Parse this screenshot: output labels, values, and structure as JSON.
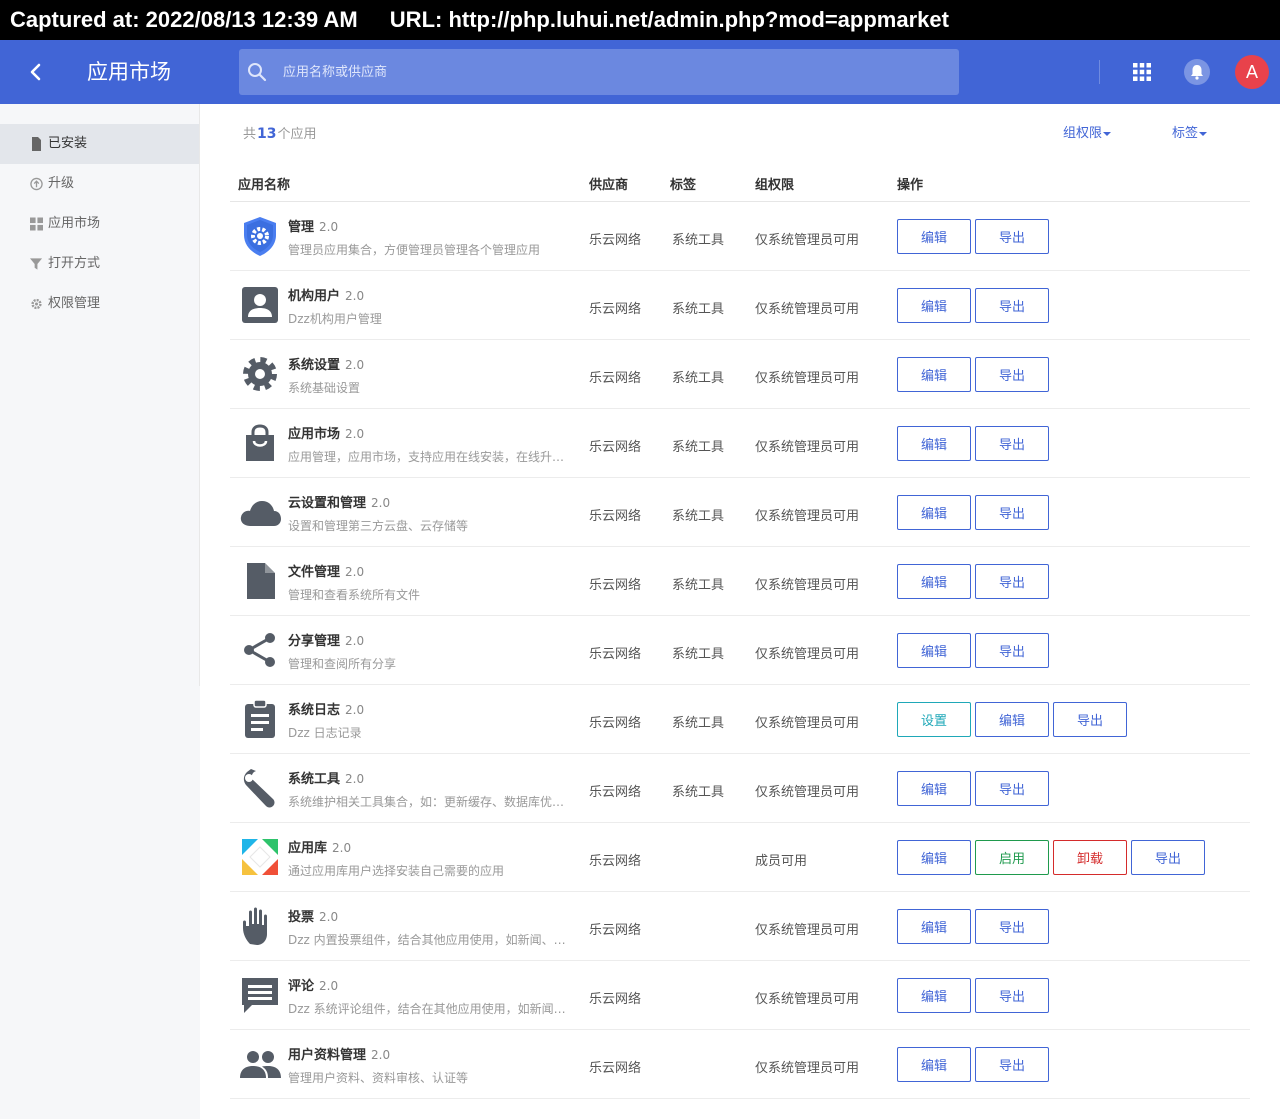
{
  "capture": {
    "time": "Captured at: 2022/08/13 12:39 AM",
    "url": "URL: http://php.luhui.net/admin.php?mod=appmarket"
  },
  "header": {
    "title": "应用市场",
    "search_placeholder": "应用名称或供应商",
    "avatar_letter": "A",
    "icons": [
      "back-icon",
      "search-icon",
      "apps-grid-icon",
      "bell-icon"
    ]
  },
  "colors": {
    "primary": "#4165d6",
    "avatar": "#e8424b",
    "setting": "#1fa8b8",
    "enable": "#1f9a4d",
    "uninstall": "#d42b2b"
  },
  "sidebar": {
    "items": [
      {
        "label": "已安装",
        "icon": "file-icon",
        "active": true
      },
      {
        "label": "升级",
        "icon": "upgrade-icon",
        "active": false
      },
      {
        "label": "应用市场",
        "icon": "grid-icon",
        "active": false
      },
      {
        "label": "打开方式",
        "icon": "filter-icon",
        "active": false
      },
      {
        "label": "权限管理",
        "icon": "gear-icon",
        "active": false
      }
    ]
  },
  "summary": {
    "prefix": "共",
    "count": "13",
    "suffix": "个应用"
  },
  "filters": {
    "group_perm": "组权限",
    "tag": "标签"
  },
  "columns": {
    "name": "应用名称",
    "vendor": "供应商",
    "tag": "标签",
    "perm": "组权限",
    "ops": "操作"
  },
  "apps": [
    {
      "name": "管理",
      "version": "2.0",
      "desc": "管理员应用集合，方便管理员管理各个管理应用",
      "vendor": "乐云网络",
      "tag": "系统工具",
      "perm": "仅系统管理员可用",
      "icon": "shield-gear-icon",
      "buttons": [
        {
          "label": "编辑",
          "style": ""
        },
        {
          "label": "导出",
          "style": ""
        }
      ]
    },
    {
      "name": "机构用户",
      "version": "2.0",
      "desc": "Dzz机构用户管理",
      "vendor": "乐云网络",
      "tag": "系统工具",
      "perm": "仅系统管理员可用",
      "icon": "account-box-icon",
      "buttons": [
        {
          "label": "编辑",
          "style": ""
        },
        {
          "label": "导出",
          "style": ""
        }
      ]
    },
    {
      "name": "系统设置",
      "version": "2.0",
      "desc": "系统基础设置",
      "vendor": "乐云网络",
      "tag": "系统工具",
      "perm": "仅系统管理员可用",
      "icon": "settings-icon",
      "buttons": [
        {
          "label": "编辑",
          "style": ""
        },
        {
          "label": "导出",
          "style": ""
        }
      ]
    },
    {
      "name": "应用市场",
      "version": "2.0",
      "desc": "应用管理，应用市场，支持应用在线安装，在线升级等",
      "vendor": "乐云网络",
      "tag": "系统工具",
      "perm": "仅系统管理员可用",
      "icon": "shopping-bag-icon",
      "buttons": [
        {
          "label": "编辑",
          "style": ""
        },
        {
          "label": "导出",
          "style": ""
        }
      ]
    },
    {
      "name": "云设置和管理",
      "version": "2.0",
      "desc": "设置和管理第三方云盘、云存储等",
      "vendor": "乐云网络",
      "tag": "系统工具",
      "perm": "仅系统管理员可用",
      "icon": "cloud-icon",
      "buttons": [
        {
          "label": "编辑",
          "style": ""
        },
        {
          "label": "导出",
          "style": ""
        }
      ]
    },
    {
      "name": "文件管理",
      "version": "2.0",
      "desc": "管理和查看系统所有文件",
      "vendor": "乐云网络",
      "tag": "系统工具",
      "perm": "仅系统管理员可用",
      "icon": "document-icon",
      "buttons": [
        {
          "label": "编辑",
          "style": ""
        },
        {
          "label": "导出",
          "style": ""
        }
      ]
    },
    {
      "name": "分享管理",
      "version": "2.0",
      "desc": "管理和查阅所有分享",
      "vendor": "乐云网络",
      "tag": "系统工具",
      "perm": "仅系统管理员可用",
      "icon": "share-icon",
      "buttons": [
        {
          "label": "编辑",
          "style": ""
        },
        {
          "label": "导出",
          "style": ""
        }
      ]
    },
    {
      "name": "系统日志",
      "version": "2.0",
      "desc": "Dzz 日志记录",
      "vendor": "乐云网络",
      "tag": "系统工具",
      "perm": "仅系统管理员可用",
      "icon": "clipboard-icon",
      "buttons": [
        {
          "label": "设置",
          "style": "teal"
        },
        {
          "label": "编辑",
          "style": ""
        },
        {
          "label": "导出",
          "style": ""
        }
      ]
    },
    {
      "name": "系统工具",
      "version": "2.0",
      "desc": "系统维护相关工具集合，如：更新缓存、数据库优化等",
      "vendor": "乐云网络",
      "tag": "系统工具",
      "perm": "仅系统管理员可用",
      "icon": "wrench-icon",
      "buttons": [
        {
          "label": "编辑",
          "style": ""
        },
        {
          "label": "导出",
          "style": ""
        }
      ]
    },
    {
      "name": "应用库",
      "version": "2.0",
      "desc": "通过应用库用户选择安装自己需要的应用",
      "vendor": "乐云网络",
      "tag": "",
      "perm": "成员可用",
      "icon": "app-library-icon",
      "buttons": [
        {
          "label": "编辑",
          "style": ""
        },
        {
          "label": "启用",
          "style": "green"
        },
        {
          "label": "卸载",
          "style": "red"
        },
        {
          "label": "导出",
          "style": ""
        }
      ]
    },
    {
      "name": "投票",
      "version": "2.0",
      "desc": "Dzz 内置投票组件，结合其他应用使用，如新闻、文档等",
      "vendor": "乐云网络",
      "tag": "",
      "perm": "仅系统管理员可用",
      "icon": "hand-icon",
      "buttons": [
        {
          "label": "编辑",
          "style": ""
        },
        {
          "label": "导出",
          "style": ""
        }
      ]
    },
    {
      "name": "评论",
      "version": "2.0",
      "desc": "Dzz 系统评论组件，结合在其他应用使用，如新闻、文档等",
      "vendor": "乐云网络",
      "tag": "",
      "perm": "仅系统管理员可用",
      "icon": "comment-icon",
      "buttons": [
        {
          "label": "编辑",
          "style": ""
        },
        {
          "label": "导出",
          "style": ""
        }
      ]
    },
    {
      "name": "用户资料管理",
      "version": "2.0",
      "desc": "管理用户资料、资料审核、认证等",
      "vendor": "乐云网络",
      "tag": "",
      "perm": "仅系统管理员可用",
      "icon": "people-icon",
      "buttons": [
        {
          "label": "编辑",
          "style": ""
        },
        {
          "label": "导出",
          "style": ""
        }
      ]
    }
  ]
}
